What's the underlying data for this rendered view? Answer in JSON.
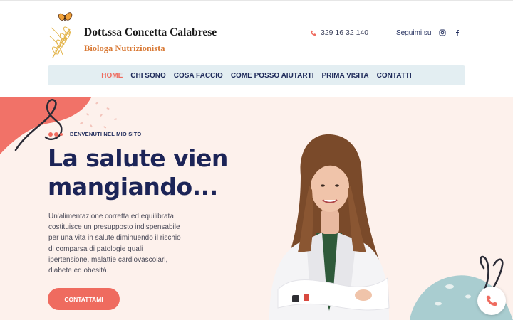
{
  "brand": {
    "name": "Dott.ssa Concetta Calabrese",
    "subtitle": "Biologa Nutrizionista"
  },
  "contact": {
    "phone": "329 16 32 140",
    "follow_label": "Seguimi su",
    "instagram_icon": "instagram-icon",
    "facebook_icon": "facebook-icon"
  },
  "nav": {
    "items": [
      {
        "label": "HOME",
        "active": true
      },
      {
        "label": "CHI SONO",
        "active": false
      },
      {
        "label": "COSA FACCIO",
        "active": false
      },
      {
        "label": "COME POSSO AIUTARTI",
        "active": false
      },
      {
        "label": "PRIMA VISITA",
        "active": false
      },
      {
        "label": "CONTATTI",
        "active": false
      }
    ]
  },
  "hero": {
    "tagline": "BENVENUTI NEL MIO SITO",
    "headline": "La salute vien mangiando...",
    "description": "Un'alimentazione corretta ed equilibrata costituisce un presupposto indispensabile per una vita in salute diminuendo il rischio di comparsa di patologie quali ipertensione, malattie cardiovascolari, diabete ed obesità.",
    "cta_label": "CONTATTAMI"
  },
  "colors": {
    "accent": "#ef6b5f",
    "navy": "#1c2457",
    "hero_bg": "#fdf1ec",
    "nav_bg": "#e3eef2",
    "logo_orange": "#d97a36"
  }
}
